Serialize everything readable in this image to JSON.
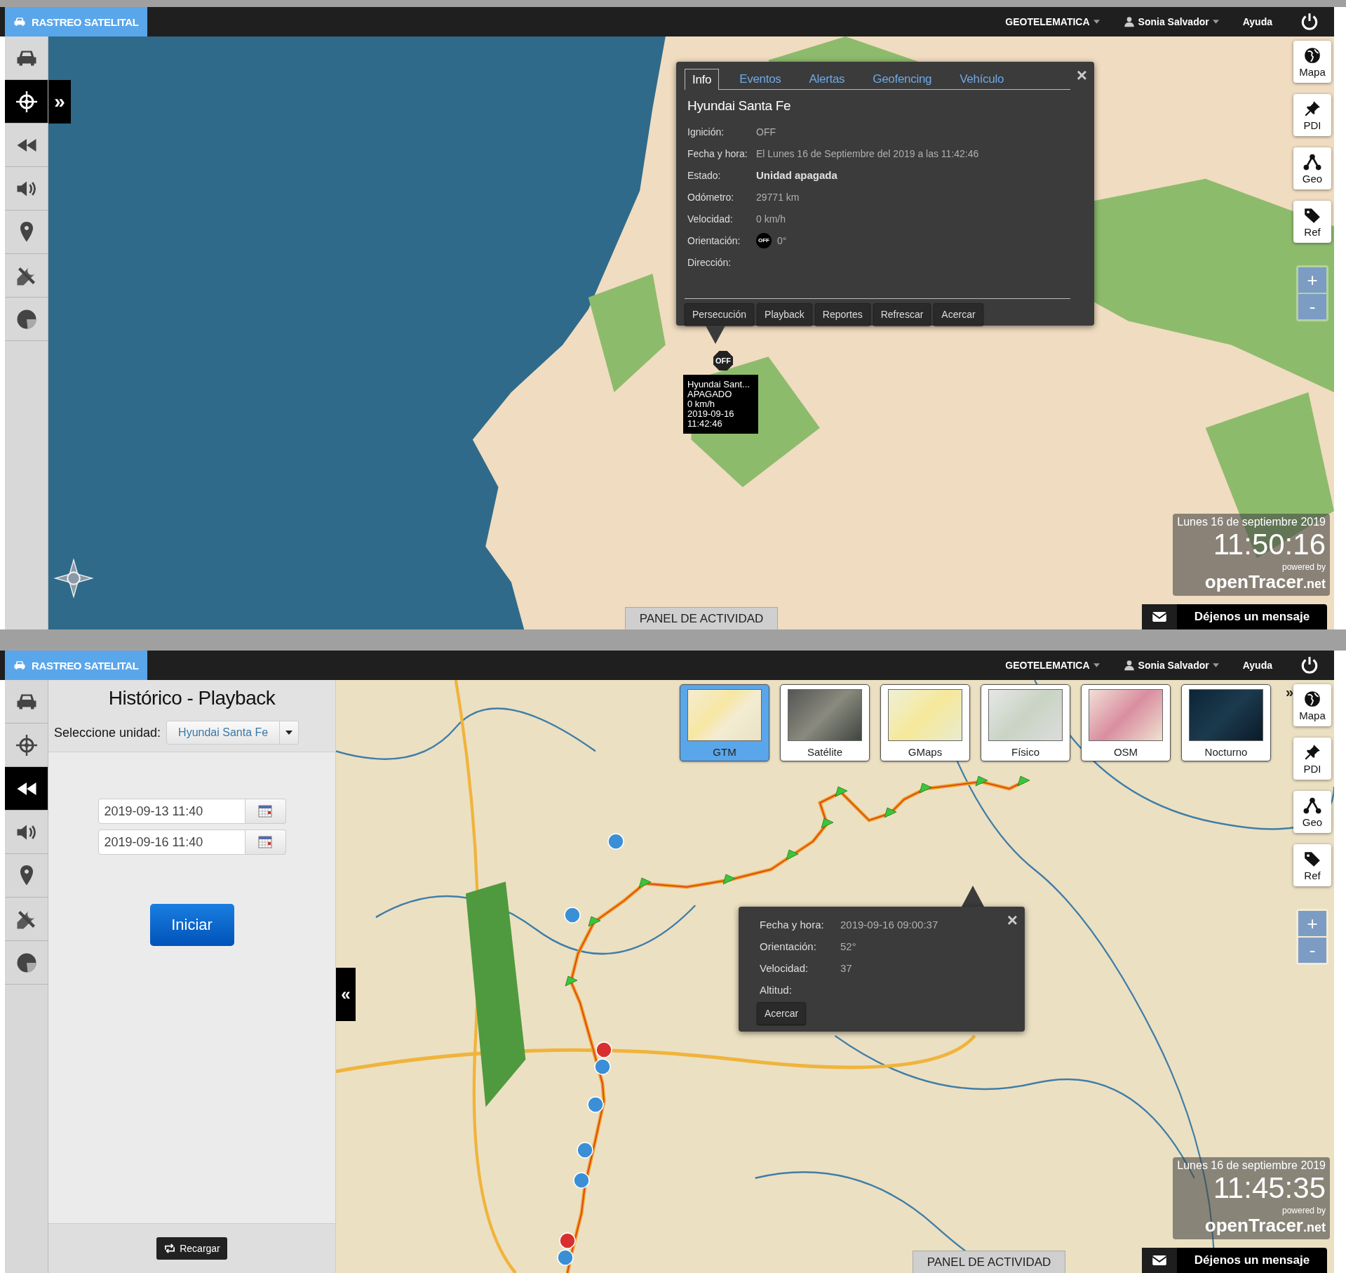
{
  "screens": [
    {
      "header": {
        "brand": "RASTREO SATELITAL",
        "menu": [
          {
            "label": "GEOTELEMATICA",
            "dropdown": true
          },
          {
            "label": "Sonia Salvador",
            "dropdown": true
          },
          {
            "label": "Ayuda",
            "dropdown": false
          }
        ]
      },
      "sidebar": {
        "items": [
          {
            "selected": false
          },
          {
            "selected": true
          },
          {
            "selected": false
          },
          {
            "selected": false
          },
          {
            "selected": false
          },
          {
            "selected": false
          },
          {
            "selected": false
          }
        ],
        "expand": "»"
      },
      "map": {
        "vehicle_marker": {
          "label": "OFF",
          "tooltip": [
            "Hyundai Sant...",
            "APAGADO",
            "0 km/h",
            "2019-09-16",
            "11:42:46"
          ]
        },
        "info_popup": {
          "tabs": [
            {
              "label": "Info",
              "selected": true
            },
            {
              "label": "Eventos",
              "selected": false
            },
            {
              "label": "Alertas",
              "selected": false
            },
            {
              "label": "Geofencing",
              "selected": false
            },
            {
              "label": "Vehículo",
              "selected": false
            }
          ],
          "close": "×",
          "title": "Hyundai Santa Fe",
          "fields": [
            {
              "label": "Ignición:",
              "value": "OFF",
              "emphasis": false
            },
            {
              "label": "Fecha y hora:",
              "value": "El Lunes 16 de Septiembre del 2019 a las 11:42:46",
              "emphasis": false
            },
            {
              "label": "Estado:",
              "value": "Unidad apagada",
              "emphasis": true
            },
            {
              "label": "Odómetro:",
              "value": "29771 km",
              "emphasis": false
            },
            {
              "label": "Velocidad:",
              "value": "0 km/h",
              "emphasis": false
            },
            {
              "label": "Orientación:",
              "value": "0°",
              "badge": "OFF",
              "emphasis": false
            },
            {
              "label": "Dirección:"
            }
          ],
          "buttons": [
            "Persecución",
            "Playback",
            "Reportes",
            "Refrescar",
            "Acercar"
          ]
        },
        "controls": [
          "Mapa",
          "PDI",
          "Geo",
          "Ref"
        ],
        "zoom": [
          "+",
          "-"
        ],
        "clock": {
          "date": "Lunes 16 de septiembre 2019",
          "time": "11:50:16"
        },
        "logo": {
          "powered": "powered by",
          "name": "openTracer",
          "suffix": ".net"
        },
        "message": "Déjenos un mensaje",
        "activity_tab": "PANEL DE ACTIVIDAD"
      }
    },
    {
      "header": {
        "brand": "RASTREO SATELITAL",
        "menu": [
          {
            "label": "GEOTELEMATICA",
            "dropdown": true
          },
          {
            "label": "Sonia Salvador",
            "dropdown": true
          },
          {
            "label": "Ayuda",
            "dropdown": false
          }
        ]
      },
      "sidebar": {
        "items": [
          {
            "selected": false
          },
          {
            "selected": false
          },
          {
            "selected": true
          },
          {
            "selected": false
          },
          {
            "selected": false
          },
          {
            "selected": false
          },
          {
            "selected": false
          }
        ]
      },
      "panel": {
        "title": "Histórico - Playback",
        "unit_label": "Seleccione unidad:",
        "unit_value": "Hyundai Santa Fe",
        "dates": [
          "2019-09-13 11:40",
          "2019-09-16 11:40"
        ],
        "start": "Iniciar",
        "reload": "Recargar"
      },
      "map": {
        "collapse": "«",
        "layers": {
          "items": [
            {
              "label": "GTM",
              "selected": true
            },
            {
              "label": "Satélite",
              "selected": false
            },
            {
              "label": "GMaps",
              "selected": false
            },
            {
              "label": "Físico",
              "selected": false
            },
            {
              "label": "OSM",
              "selected": false
            },
            {
              "label": "Nocturno",
              "selected": false
            }
          ],
          "more": "»"
        },
        "point_popup": {
          "close": "×",
          "fields": [
            {
              "label": "Fecha y hora:",
              "value": "2019-09-16 09:00:37"
            },
            {
              "label": "Orientación:",
              "value": "52°"
            },
            {
              "label": "Velocidad:",
              "value": "37"
            },
            {
              "label": "Altitud:"
            }
          ],
          "buttons": [
            "Acercar"
          ]
        },
        "controls": [
          "Mapa",
          "PDI",
          "Geo",
          "Ref"
        ],
        "zoom": [
          "+",
          "-"
        ],
        "clock": {
          "date": "Lunes 16 de septiembre 2019",
          "time": "11:45:35"
        },
        "logo": {
          "powered": "powered by",
          "name": "openTracer",
          "suffix": ".net"
        },
        "message": "Déjenos un mensaje",
        "activity_tab": "PANEL DE ACTIVIDAD"
      }
    }
  ]
}
